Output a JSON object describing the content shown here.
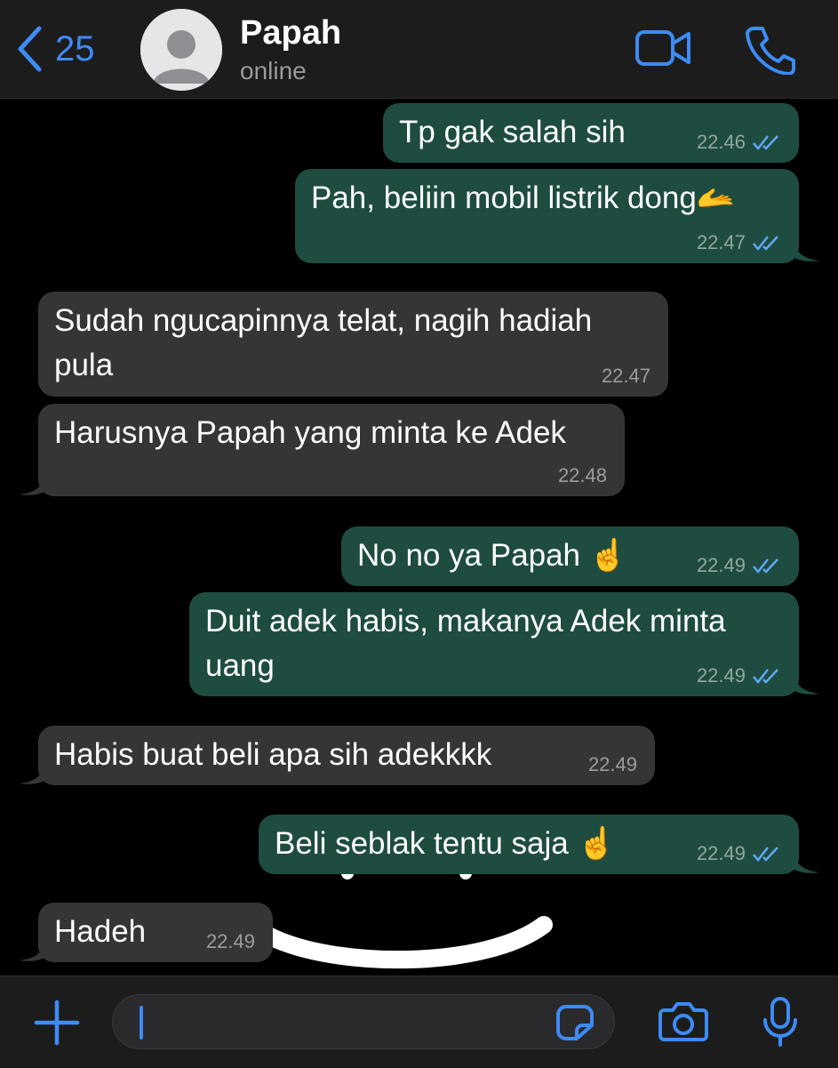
{
  "header": {
    "back_count": "25",
    "contact_name": "Papah",
    "contact_status": "online"
  },
  "icons": {
    "back": "chevron-left-icon",
    "video": "video-camera-icon",
    "call": "phone-icon",
    "attach": "plus-icon",
    "sticker": "sticker-icon",
    "camera": "camera-icon",
    "mic": "microphone-icon"
  },
  "colors": {
    "accent": "#3d8bf4",
    "outgoing_bubble": "#1e4c40",
    "incoming_bubble": "#353537",
    "read_ticks": "#5fa9f5",
    "background": "#000000"
  },
  "messages": [
    {
      "direction": "out",
      "text": "Tp gak salah sih",
      "time": "22.46",
      "status": "read"
    },
    {
      "direction": "out",
      "text": "Pah, beliin mobil listrik dong🫴",
      "time": "22.47",
      "status": "read"
    },
    {
      "direction": "in",
      "text": "Sudah ngucapinnya telat, nagih hadiah pula",
      "time": "22.47"
    },
    {
      "direction": "in",
      "text": "Harusnya Papah yang minta ke Adek",
      "time": "22.48"
    },
    {
      "direction": "out",
      "text": "No no ya Papah ☝️",
      "time": "22.49",
      "status": "read"
    },
    {
      "direction": "out",
      "text": "Duit adek habis, makanya Adek minta uang",
      "time": "22.49",
      "status": "read"
    },
    {
      "direction": "in",
      "text": "Habis buat beli apa sih adekkkk",
      "time": "22.49"
    },
    {
      "direction": "out",
      "text": "Beli seblak tentu saja ☝️",
      "time": "22.49",
      "status": "read"
    },
    {
      "direction": "in",
      "text": "Hadeh",
      "time": "22.49"
    }
  ],
  "composer": {
    "input_value": "",
    "input_placeholder": ""
  }
}
